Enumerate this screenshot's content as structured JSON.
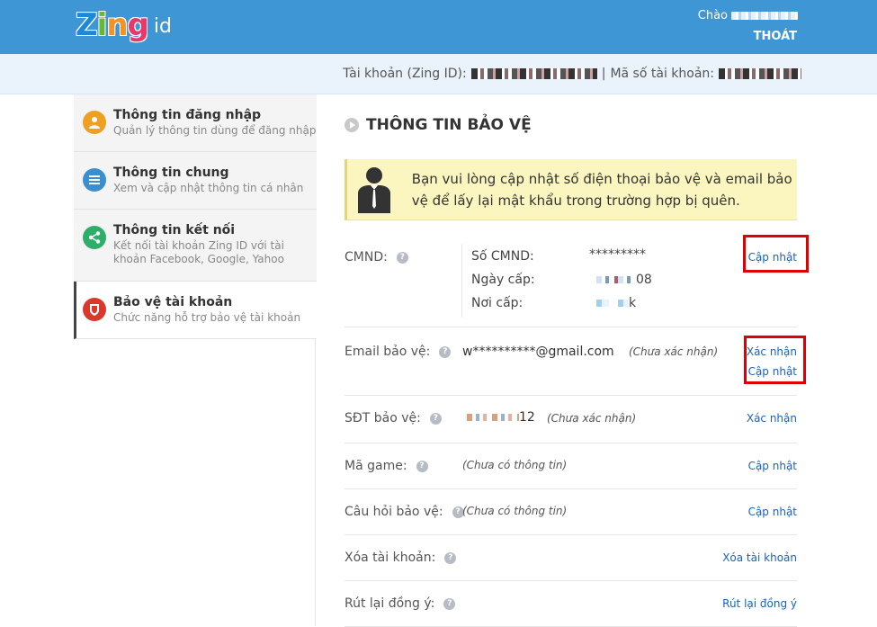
{
  "header": {
    "logo_text": "Zing",
    "logo_suffix": "id",
    "greeting": "Chào",
    "logout": "THOÁT"
  },
  "account_bar": {
    "zing_id_label": "Tài khoản (Zing ID):",
    "separator": "|",
    "account_code_label": "Mã số tài khoản:"
  },
  "sidebar": {
    "items": [
      {
        "title": "Thông tin đăng nhập",
        "subtitle": "Quản lý thông tin dùng để đăng nhập",
        "icon": "user-icon",
        "color": "#f0a020"
      },
      {
        "title": "Thông tin chung",
        "subtitle": "Xem và cập nhật thông tin cá nhân",
        "icon": "list-icon",
        "color": "#3b8fd0"
      },
      {
        "title": "Thông tin kết nối",
        "subtitle": "Kết nối tài khoản Zing ID với tài khoản Facebook, Google, Yahoo",
        "icon": "share-icon",
        "color": "#2fae6a"
      },
      {
        "title": "Bảo vệ tài khoản",
        "subtitle": "Chức năng hỗ trợ bảo vệ tài khoản",
        "icon": "shield-icon",
        "color": "#d9382d"
      }
    ]
  },
  "main": {
    "section_title": "THÔNG TIN BẢO VỆ",
    "notice": "Bạn vui lòng cập nhật số điện thoại bảo vệ và email bảo vệ để lấy lại mật khẩu trong trường hợp bị quên.",
    "cmnd": {
      "label": "CMND:",
      "number_label": "Số CMND:",
      "number_value": "*********",
      "date_label": "Ngày cấp:",
      "date_suffix": "08",
      "place_label": "Nơi cấp:",
      "place_suffix": "k",
      "action": "Cập nhật"
    },
    "email": {
      "label": "Email bảo vệ:",
      "value": "w**********@gmail.com",
      "status": "(Chưa xác nhận)",
      "action_confirm": "Xác nhận",
      "action_update": "Cập nhật"
    },
    "phone": {
      "label": "SĐT bảo vệ:",
      "suffix": "12",
      "status": "(Chưa xác nhận)",
      "action": "Xác nhận"
    },
    "game_code": {
      "label": "Mã game:",
      "status": "(Chưa có thông tin)",
      "action": "Cập nhật"
    },
    "question": {
      "label": "Câu hỏi bảo vệ:",
      "status": "(Chưa có thông tin)",
      "action": "Cập nhật"
    },
    "delete": {
      "label": "Xóa tài khoản:",
      "action": "Xóa tài khoản"
    },
    "withdraw": {
      "label": "Rút lại đồng ý:",
      "action": "Rút lại đồng ý"
    },
    "help_glyph": "?"
  },
  "colors": {
    "header_blue": "#3e97d4",
    "link": "#1a63b8",
    "highlight_box": "#e00000",
    "notice_bg": "#fbf6c0"
  }
}
